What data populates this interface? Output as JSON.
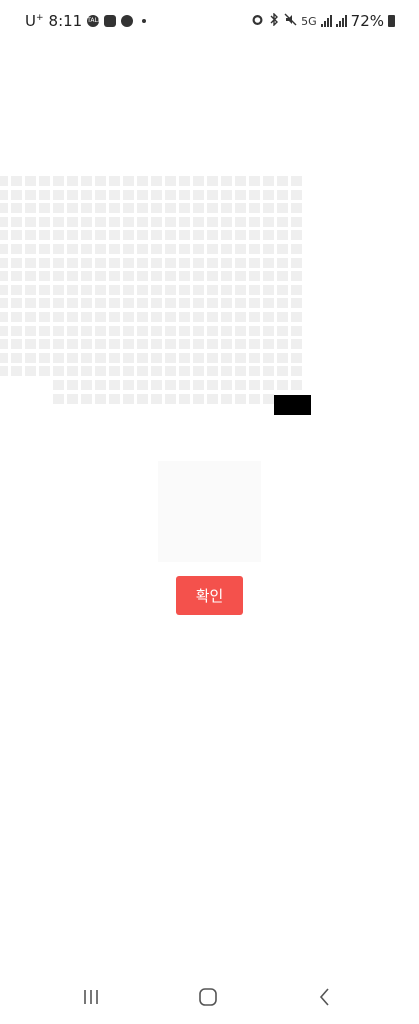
{
  "status_bar": {
    "carrier": "U",
    "carrier_sup": "+",
    "time": "8:11",
    "left_icons": [
      "talk-icon",
      "gallery-icon",
      "cloud-icon"
    ],
    "right_icons": [
      "alarm-icon",
      "bluetooth-icon",
      "mute-icon",
      "5g-icon",
      "signal-icon",
      "signal-icon"
    ],
    "network_label": "5G",
    "battery": "72%"
  },
  "seat_map": {
    "block_color": "#efefef",
    "selected_color": "#000000"
  },
  "confirm_button": {
    "label": "확인",
    "color": "#f4514c"
  },
  "nav_bar": {
    "items": [
      "recent-apps-icon",
      "home-icon",
      "back-icon"
    ]
  }
}
